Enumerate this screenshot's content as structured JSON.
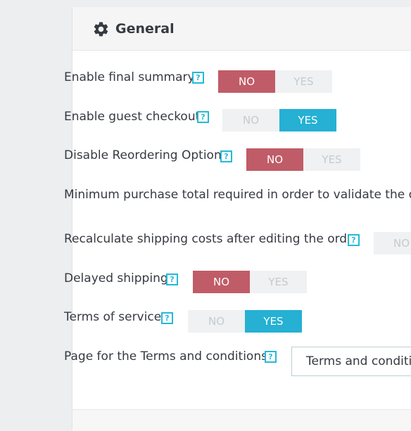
{
  "panel": {
    "title": "General",
    "icon": "gear-icon"
  },
  "help_glyph": "?",
  "switch_labels": {
    "no": "NO",
    "yes": "YES"
  },
  "colors": {
    "no_active": "#c05c67",
    "yes_active": "#25b0d4",
    "help": "#25b9d7"
  },
  "settings": [
    {
      "label": "Enable final summary",
      "value": "NO"
    },
    {
      "label": "Enable guest checkout",
      "value": "YES"
    },
    {
      "label": "Disable Reordering Option",
      "value": "NO"
    },
    {
      "label": "Minimum purchase total required in order to validate the ord"
    },
    {
      "label": "Recalculate shipping costs after editing the order",
      "switch_visible": "NO"
    },
    {
      "label": "Delayed shipping",
      "value": "NO"
    },
    {
      "label": "Terms of service",
      "value": "YES"
    },
    {
      "label": "Page for the Terms and conditions",
      "select_value": "Terms and conditio"
    }
  ]
}
